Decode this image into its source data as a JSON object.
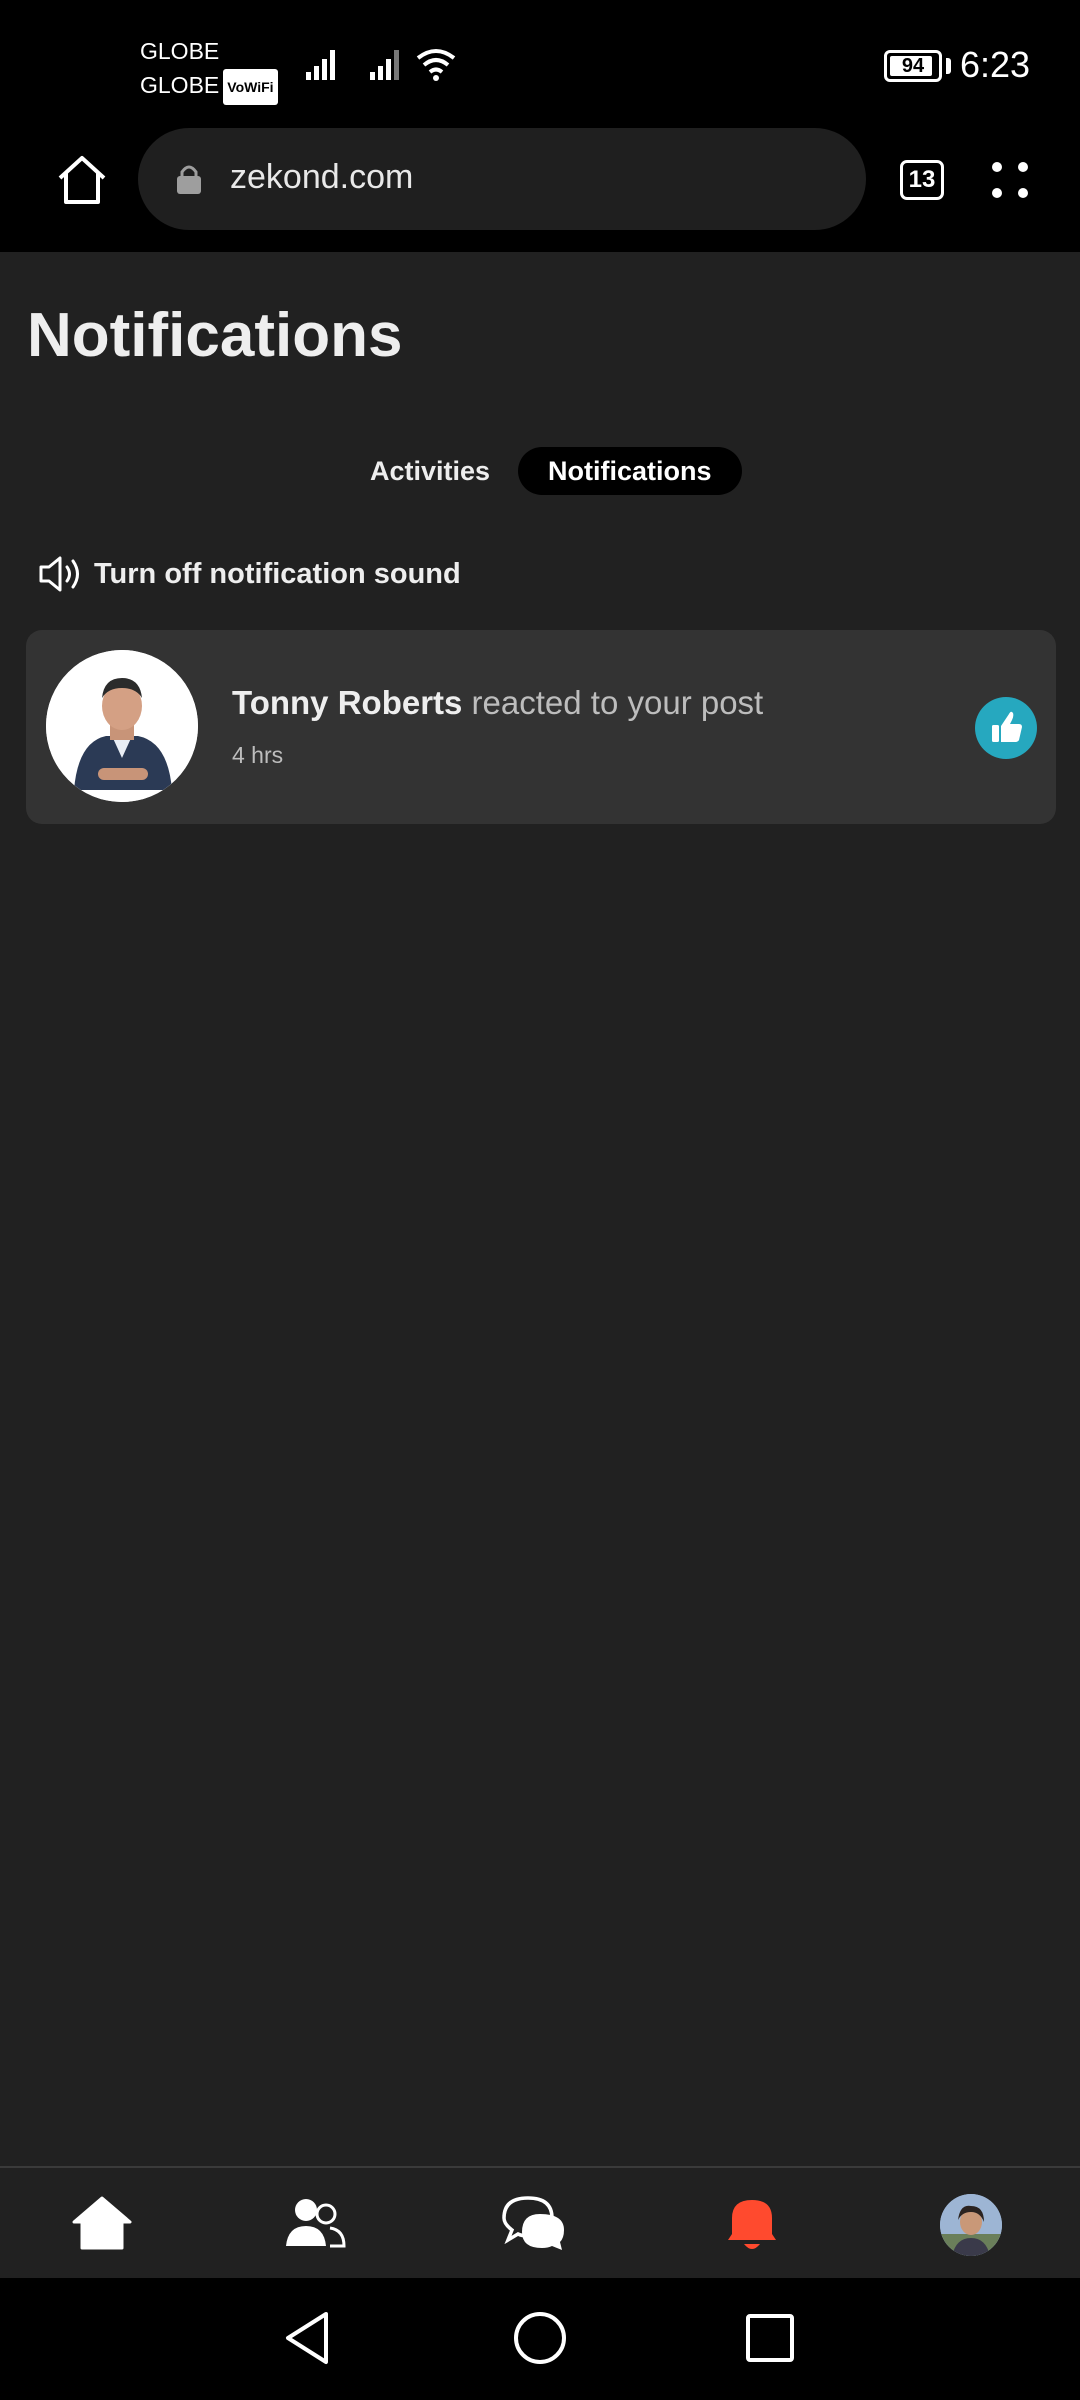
{
  "status_bar": {
    "carrier_1": "GLOBE",
    "carrier_2": "GLOBE",
    "vowifi_badge": "VoWiFi",
    "battery_level": "94",
    "time": "6:23"
  },
  "browser": {
    "url": "zekond.com",
    "tab_count": "13"
  },
  "page": {
    "title": "Notifications",
    "tabs": [
      {
        "label": "Activities",
        "active": false
      },
      {
        "label": "Notifications",
        "active": true
      }
    ],
    "sound_toggle_label": "Turn off notification sound"
  },
  "notifications": [
    {
      "actor": "Tonny Roberts",
      "action": " reacted to your post",
      "time": "4 hrs",
      "reaction_icon": "thumbs-up-icon",
      "reaction_color": "#26a8bf"
    }
  ],
  "bottom_nav": {
    "items": [
      "home-icon",
      "friends-icon",
      "messages-icon",
      "notifications-bell-icon",
      "profile-avatar"
    ],
    "active_color": "#ff4a2e"
  },
  "system_nav": [
    "back-icon",
    "home-circle-icon",
    "recents-icon"
  ]
}
